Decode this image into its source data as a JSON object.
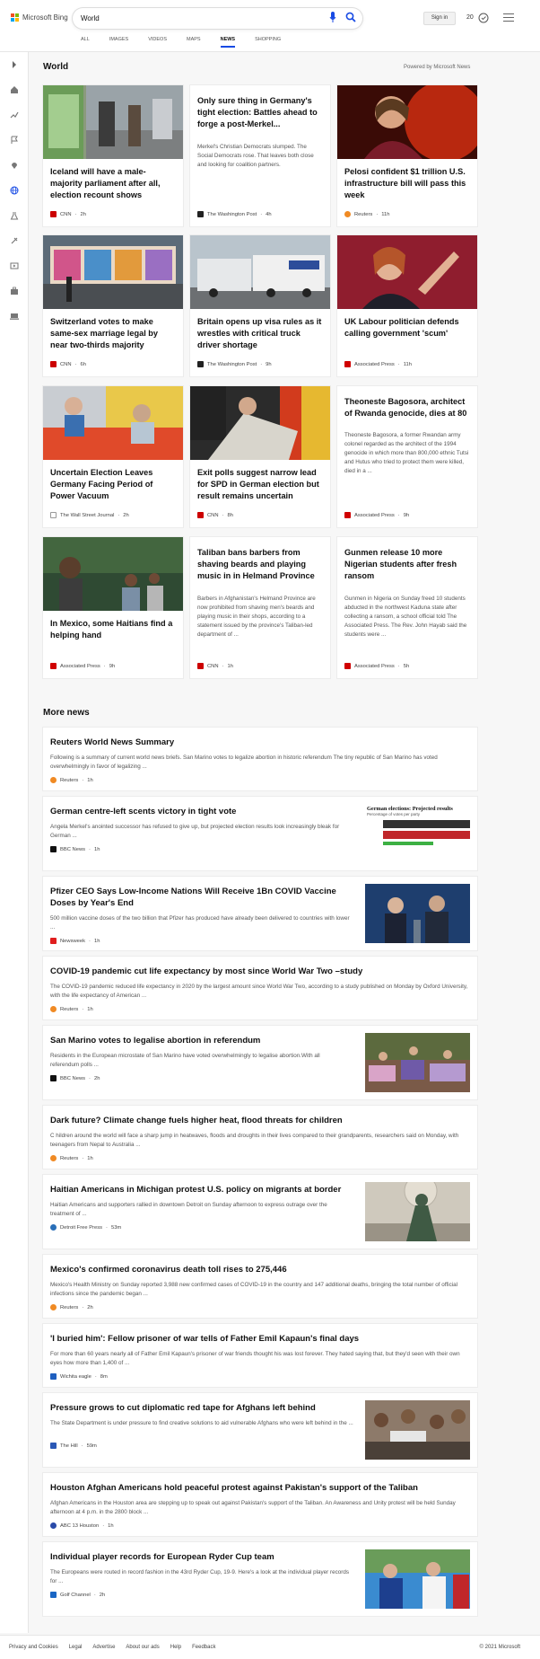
{
  "header": {
    "brand": "Microsoft Bing",
    "search_value": "World",
    "sign_in": "Sign in",
    "points": "20",
    "tabs": [
      "ALL",
      "IMAGES",
      "VIDEOS",
      "MAPS",
      "NEWS",
      "SHOPPING"
    ],
    "active_tab": "NEWS"
  },
  "section": {
    "title": "World",
    "powered_by": "Powered by Microsoft News"
  },
  "cards": [
    {
      "title": "Iceland will have a male-majority parliament after all, election recount shows",
      "source": "CNN",
      "time": "2h",
      "snippet": ""
    },
    {
      "title": "Only sure thing in Germany's tight election: Battles ahead to forge a post-Merkel...",
      "source": "The Washington Post",
      "time": "4h",
      "snippet": "Merkel's Christian Democrats slumped. The Social Democrats rose. That leaves both close and looking for coalition partners."
    },
    {
      "title": "Pelosi confident $1 trillion U.S. infrastructure bill will pass this week",
      "source": "Reuters",
      "time": "11h",
      "snippet": ""
    },
    {
      "title": "Switzerland votes to make same-sex marriage legal by near two-thirds majority",
      "source": "CNN",
      "time": "6h",
      "snippet": ""
    },
    {
      "title": "Britain opens up visa rules as it wrestles with critical truck driver shortage",
      "source": "The Washington Post",
      "time": "9h",
      "snippet": ""
    },
    {
      "title": "UK Labour politician defends calling government 'scum'",
      "source": "Associated Press",
      "time": "11h",
      "snippet": ""
    },
    {
      "title": "Uncertain Election Leaves Germany Facing Period of Power Vacuum",
      "source": "The Wall Street Journal",
      "time": "2h",
      "snippet": ""
    },
    {
      "title": "Exit polls suggest narrow lead for SPD in German election but result remains uncertain",
      "source": "CNN",
      "time": "8h",
      "snippet": ""
    },
    {
      "title": "Theoneste Bagosora, architect of Rwanda genocide, dies at 80",
      "source": "Associated Press",
      "time": "9h",
      "snippet": "Theoneste Bagosora, a former Rwandan army colonel regarded as the architect of the 1994 genocide in which more than 800,000 ethnic Tutsi and Hutus who tried to protect them were killed, died in a ..."
    },
    {
      "title": "In Mexico, some Haitians find a helping hand",
      "source": "Associated Press",
      "time": "9h",
      "snippet": ""
    },
    {
      "title": "Taliban bans barbers from shaving beards and playing music in in Helmand Province",
      "source": "CNN",
      "time": "1h",
      "snippet": "Barbers in Afghanistan's Helmand Province are now prohibited from shaving men's beards and playing music in their shops, according to a statement issued by the province's Taliban-led department of ..."
    },
    {
      "title": "Gunmen release 10 more Nigerian students after fresh ransom",
      "source": "Associated Press",
      "time": "5h",
      "snippet": "Gunmen in Nigeria on Sunday freed 10 students abducted in the northwest Kaduna state after collecting a ransom, a school official told The Associated Press. The Rev. John Hayab said the students were ..."
    }
  ],
  "more_news_title": "More news",
  "more_news": [
    {
      "title": "Reuters World News Summary",
      "snippet": "Following is a summary of current world news briefs. San Marino votes to legalize abortion in historic referendum The tiny republic of San Marino has voted overwhelmingly in favor of legalizing ...",
      "source": "Reuters",
      "time": "1h"
    },
    {
      "title": "German centre-left scents victory in tight vote",
      "snippet": "Angela Merkel's anointed successor has refused to give up, but projected election results look increasingly bleak for German ...",
      "source": "BBC News",
      "time": "1h"
    },
    {
      "title": "Pfizer CEO Says Low-Income Nations Will Receive 1Bn COVID Vaccine Doses by Year's End",
      "snippet": "500 million vaccine doses of the two billion that Pfizer has produced have already been delivered to countries with lower ...",
      "source": "Newsweek",
      "time": "1h"
    },
    {
      "title": "COVID-19 pandemic cut life expectancy by most since World War Two –study",
      "snippet": "The COVID-19 pandemic reduced life expectancy in 2020 by the largest amount since World War Two, according to a study published on Monday by Oxford University, with the life expectancy of American ...",
      "source": "Reuters",
      "time": "1h"
    },
    {
      "title": "San Marino votes to legalise abortion in referendum",
      "snippet": "Residents in the European microstate of San Marino have voted overwhelmingly to legalise abortion.With all referendum polls ...",
      "source": "BBC News",
      "time": "2h"
    },
    {
      "title": "Dark future? Climate change fuels higher heat, flood threats for children",
      "snippet": "C hildren around the world will face a sharp jump in heatwaves, floods and droughts in their lives compared to their grandparents, researchers said on Monday, with teenagers from Nepal to Australia ...",
      "source": "Reuters",
      "time": "1h"
    },
    {
      "title": "Haitian Americans in Michigan protest U.S. policy on migrants at border",
      "snippet": "Haitian Americans and supporters rallied in downtown Detroit on Sunday afternoon to express outrage over the treatment of ...",
      "source": "Detroit Free Press",
      "time": "53m"
    },
    {
      "title": "Mexico's confirmed coronavirus death toll rises to 275,446",
      "snippet": "Mexico's Health Ministry on Sunday reported 3,988 new confirmed cases of COVID-19 in the country and 147 additional deaths, bringing the total number of official infections since the pandemic began ...",
      "source": "Reuters",
      "time": "2h"
    },
    {
      "title": "'I buried him': Fellow prisoner of war tells of Father Emil Kapaun's final days",
      "snippet": "For more than 60 years nearly all of Father Emil Kapaun's prisoner of war friends thought his was lost forever. They hated saying that, but they'd seen with their own eyes how more than 1,400 of ...",
      "source": "Wichita eagle",
      "time": "8m"
    },
    {
      "title": "Pressure grows to cut diplomatic red tape for Afghans left behind",
      "snippet": "The State Department is under pressure to find creative solutions to aid vulnerable Afghans who were left behind in the ...",
      "source": "The Hill",
      "time": "59m"
    },
    {
      "title": "Houston Afghan Americans hold peaceful protest against Pakistan's support of the Taliban",
      "snippet": "Afghan Americans in the Houston area are stepping up to speak out against Pakistan's support of the Taliban. An Awareness and Unity protest will be held Sunday afternoon at 4 p.m. in the 2800 block ...",
      "source": "ABC 13 Houston",
      "time": "1h"
    },
    {
      "title": "Individual player records for European Ryder Cup team",
      "snippet": "The Europeans were routed in record fashion in the 43rd Ryder Cup, 19-9. Here's a look at the individual player records for ...",
      "source": "Golf Channel",
      "time": "2h"
    }
  ],
  "mini_chart": {
    "title": "German elections: Projected results",
    "subtitle": "Percentage of votes per party"
  },
  "footer": {
    "links": [
      "Privacy and Cookies",
      "Legal",
      "Advertise",
      "About our ads",
      "Help",
      "Feedback"
    ],
    "copyright": "© 2021 Microsoft"
  },
  "colors": {
    "accent": "#174ae4",
    "cnn": "#cc0000",
    "reuters": "#f08a24",
    "ap": "#d00000",
    "bbc": "#111111"
  }
}
